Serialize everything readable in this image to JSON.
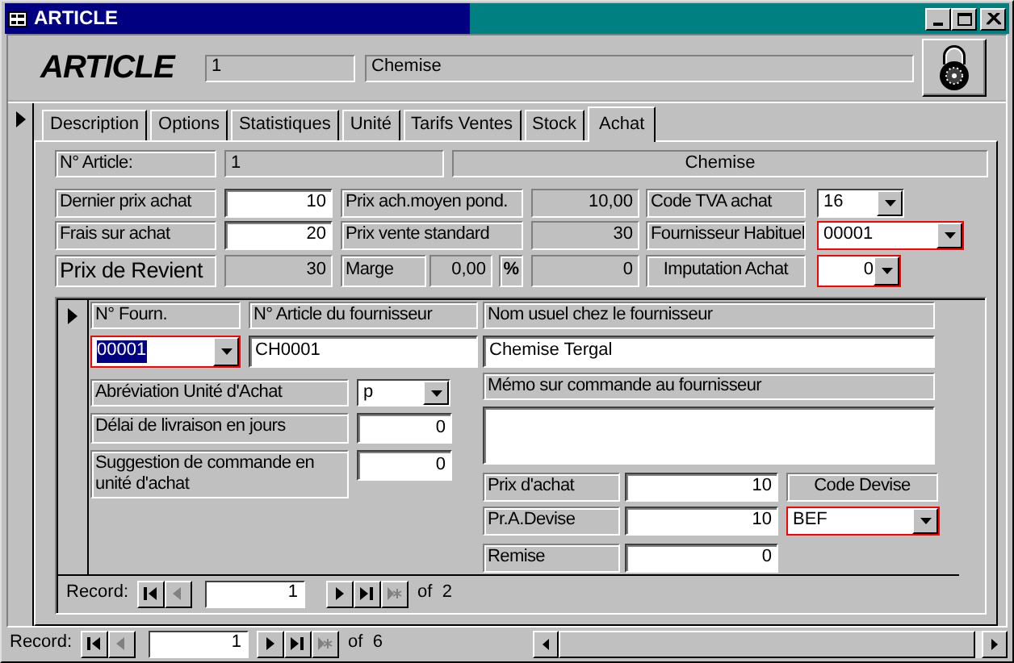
{
  "window": {
    "title": "ARTICLE"
  },
  "header": {
    "logo": "ARTICLE",
    "number": "1",
    "name": "Chemise"
  },
  "tabs": [
    {
      "label": "Description",
      "selected": false
    },
    {
      "label": "Options",
      "selected": false
    },
    {
      "label": "Statistiques",
      "selected": false
    },
    {
      "label": "Unité",
      "selected": false
    },
    {
      "label": "Tarifs Ventes",
      "selected": false
    },
    {
      "label": "Stock",
      "selected": false
    },
    {
      "label": "Achat",
      "selected": true
    }
  ],
  "article": [
    {
      "kind": "label",
      "text": "N° Article:"
    },
    {
      "kind": "readout",
      "text": "1"
    },
    {
      "kind": "readout",
      "text": "Chemise"
    }
  ],
  "price_rows": [
    [
      {
        "kind": "label",
        "text": "Dernier prix achat"
      },
      {
        "kind": "input",
        "text": "10"
      },
      {
        "kind": "label",
        "text": "Prix ach.moyen pond."
      },
      {
        "kind": "readout",
        "text": "10,00"
      },
      {
        "kind": "label",
        "text": "Code TVA achat"
      },
      {
        "kind": "combo",
        "text": "16",
        "highlighted": false
      }
    ],
    [
      {
        "kind": "label",
        "text": "Frais sur achat"
      },
      {
        "kind": "input",
        "text": "20"
      },
      {
        "kind": "label",
        "text": "Prix vente standard"
      },
      {
        "kind": "readout",
        "text": "30"
      },
      {
        "kind": "label",
        "text": "Fournisseur Habituel"
      },
      {
        "kind": "combo",
        "text": "00001",
        "highlighted": true
      }
    ],
    [
      {
        "kind": "label",
        "text": "Prix de Revient"
      },
      {
        "kind": "readout",
        "text": "30"
      },
      {
        "kind": "label",
        "text": "Marge"
      },
      {
        "kind": "readout",
        "text": "0,00"
      },
      {
        "kind": "label",
        "text": "%"
      },
      {
        "kind": "readout",
        "text": "0"
      },
      {
        "kind": "label",
        "text": "Imputation Achat"
      },
      {
        "kind": "combo",
        "text": "0",
        "highlighted": true
      }
    ]
  ],
  "suppliers": {
    "headers": [
      "N° Fourn.",
      "N° Article du fournisseur",
      "Nom usuel chez le fournisseur"
    ],
    "values": [
      {
        "kind": "combo",
        "text": "00001",
        "highlighted": true,
        "text_selected": true
      },
      {
        "kind": "input",
        "text": "CH0001"
      },
      {
        "kind": "input",
        "text": "Chemise Tergal"
      }
    ],
    "details": [
      {
        "label": "Abréviation Unité d'Achat",
        "kind": "combo",
        "value": "p"
      },
      {
        "label": "Délai de livraison en jours",
        "kind": "input",
        "value": "0"
      },
      {
        "label": "Suggestion de commande en unité d'achat",
        "kind": "input",
        "value": "0"
      }
    ],
    "memo": {
      "label": "Mémo sur commande au fournisseur"
    },
    "prices": [
      {
        "label": "Prix d'achat",
        "value": "10"
      },
      {
        "label": "Pr.A.Devise",
        "value": "10"
      },
      {
        "label": "Remise",
        "value": "0"
      }
    ],
    "currency": {
      "label": "Code Devise",
      "value": "BEF",
      "highlighted": true
    },
    "navigator": {
      "label": "Record:",
      "current": "1",
      "total": "of  2",
      "buttons": [
        {
          "kind": "first",
          "disabled": false
        },
        {
          "kind": "previous",
          "disabled": true
        },
        {
          "kind": "next",
          "disabled": false
        },
        {
          "kind": "last",
          "disabled": false
        },
        {
          "kind": "new",
          "disabled": true
        }
      ]
    }
  },
  "navigator": {
    "label": "Record:",
    "current": "1",
    "total": "of  6",
    "buttons": [
      {
        "kind": "first",
        "disabled": false
      },
      {
        "kind": "previous",
        "disabled": true
      },
      {
        "kind": "next",
        "disabled": false
      },
      {
        "kind": "last",
        "disabled": false
      },
      {
        "kind": "new",
        "disabled": true
      }
    ]
  }
}
